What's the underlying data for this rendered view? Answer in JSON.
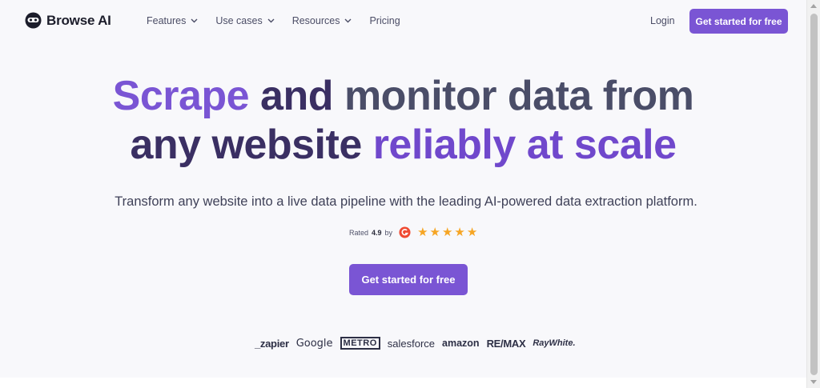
{
  "header": {
    "brand": "Browse AI",
    "nav": [
      {
        "label": "Features"
      },
      {
        "label": "Use cases"
      },
      {
        "label": "Resources"
      },
      {
        "label": "Pricing"
      }
    ],
    "login": "Login",
    "cta": "Get started for free"
  },
  "hero": {
    "title_parts": [
      [
        "Scrape ",
        "and ",
        "monitor data from"
      ],
      [
        "any website ",
        "reliably at scale"
      ]
    ],
    "subtitle": "Transform any website into a live data pipeline with the leading AI-powered data extraction platform.",
    "rating_prefix": "Rated",
    "rating_value": "4.9",
    "rating_suffix": "by",
    "stars": 5,
    "cta": "Get started for free"
  },
  "logos": {
    "zapier": "_zapier",
    "google": "Google",
    "metro": "METRO",
    "salesforce": "salesforce",
    "amazon": "amazon",
    "remax": "RE/MAX",
    "raywhite": "RayWhite."
  },
  "colors": {
    "accent": "#7a55d4",
    "star": "#f6a524",
    "g2": "#ef4a32"
  }
}
